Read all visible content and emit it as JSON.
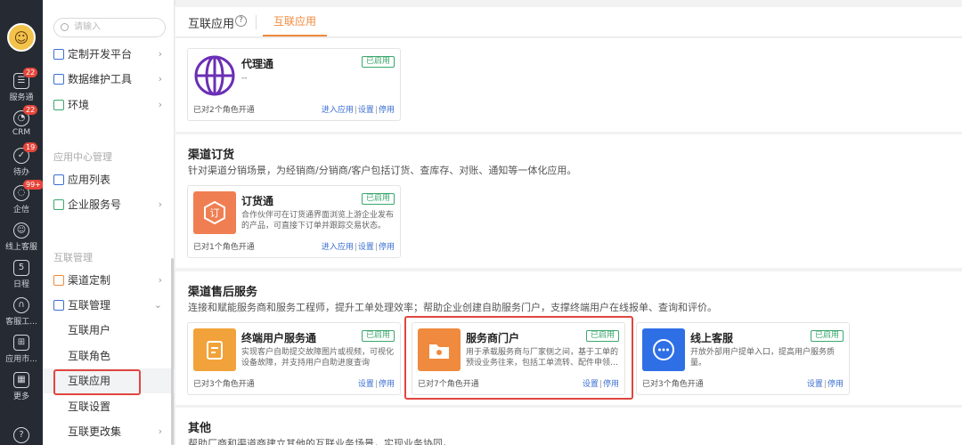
{
  "rail": {
    "items": [
      {
        "label": "服务通",
        "badge": "22",
        "glyph": "☰"
      },
      {
        "label": "CRM",
        "badge": "22",
        "glyph": "◔"
      },
      {
        "label": "待办",
        "badge": "19",
        "glyph": "✓"
      },
      {
        "label": "企信",
        "badge": "99+",
        "glyph": "◌"
      },
      {
        "label": "线上客服",
        "badge": "",
        "glyph": "☺"
      },
      {
        "label": "日程",
        "badge": "",
        "glyph": "5"
      },
      {
        "label": "客服工...",
        "badge": "",
        "glyph": "∩"
      },
      {
        "label": "应用市...",
        "badge": "",
        "glyph": "⊞"
      },
      {
        "label": "更多",
        "badge": "",
        "glyph": "▦"
      }
    ],
    "help_glyph": "?"
  },
  "menu": {
    "search_placeholder": "请输入",
    "top_items": [
      {
        "label": "定制开发平台"
      },
      {
        "label": "数据维护工具"
      },
      {
        "label": "环境"
      }
    ],
    "section_app_center": "应用中心管理",
    "app_items": [
      {
        "label": "应用列表"
      },
      {
        "label": "企业服务号"
      }
    ],
    "section_interconnect": "互联管理",
    "inter_items": [
      {
        "label": "渠道定制"
      },
      {
        "label": "互联管理"
      }
    ],
    "sub_items": [
      {
        "label": "互联用户"
      },
      {
        "label": "互联角色"
      },
      {
        "label": "互联应用"
      },
      {
        "label": "互联设置"
      },
      {
        "label": "互联更改集"
      }
    ]
  },
  "topbar": {
    "title": "互联应用",
    "help": "?",
    "tab": "互联应用"
  },
  "sections": {
    "proxy": {
      "card": {
        "name": "代理通",
        "status": "已启用",
        "desc": "--",
        "count": "已对2个角色开通",
        "actions": [
          "进入应用",
          "设置",
          "停用"
        ]
      }
    },
    "channel": {
      "title": "渠道订货",
      "desc": "针对渠道分销场景，为经销商/分销商/客户包括订货、查库存、对账、通知等一体化应用。",
      "card": {
        "name": "订货通",
        "status": "已启用",
        "desc": "合作伙伴可在订货通界面浏览上游企业发布的产品，可直接下订单并跟踪交易状态。",
        "count": "已对1个角色开通",
        "actions": [
          "进入应用",
          "设置",
          "停用"
        ]
      }
    },
    "after_sales": {
      "title": "渠道售后服务",
      "desc": "连接和赋能服务商和服务工程师，提升工单处理效率；帮助企业创建自助服务门户，支撑终端用户在线报单、查询和评价。",
      "cards": [
        {
          "name": "终端用户服务通",
          "status": "已启用",
          "desc": "实现客户自助提交故障图片或视频，可视化设备故障，并支持用户自助进度查询",
          "count": "已对3个角色开通",
          "actions": [
            "设置",
            "停用"
          ]
        },
        {
          "name": "服务商门户",
          "status": "已启用",
          "desc": "用于承载服务商与厂家侧之间，基于工单的预设业务往来，包括工单流转、配件申领…",
          "count": "已对7个角色开通",
          "actions": [
            "设置",
            "停用"
          ]
        },
        {
          "name": "线上客服",
          "status": "已启用",
          "desc": "开放外部用户提单入口，提高用户服务质量。",
          "count": "已对3个角色开通",
          "actions": [
            "设置",
            "停用"
          ]
        }
      ]
    },
    "other": {
      "title": "其他",
      "desc": "帮助厂商和渠道商建立其他的互联业务场景，实现业务协同。"
    }
  },
  "colors": {
    "accent": "#f08a3c",
    "link": "#3b6fd1",
    "enabled": "#3aa76d",
    "highlight": "#e0463f",
    "rail": "#262b33"
  }
}
